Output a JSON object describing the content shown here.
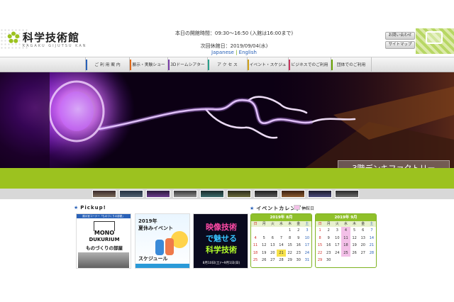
{
  "header": {
    "logo_name": "科学技術館",
    "logo_roman": "KAGAKU GIJUTSU KAN",
    "hours": "本日の開館時間：09:30～16:50 (入館は16:00まで)",
    "next_closed": "次回休館日：2019/09/04(水)",
    "lang_ja": "Japanese",
    "lang_sep": "|",
    "lang_en": "English",
    "contact_button": "お問い合わせ",
    "sitemap_button": "サイトマップ"
  },
  "nav": {
    "items": [
      {
        "label": "ご 利 用 案 内",
        "color": "#2a62b8"
      },
      {
        "label": "展示・実験ショー",
        "color": "#e06a1b"
      },
      {
        "label": "3Dドームシアター",
        "color": "#7a3ea8"
      },
      {
        "label": "ア ク セ ス",
        "color": "#2aa08c"
      },
      {
        "label": "イベント・スケジュール",
        "color": "#d0a21a"
      },
      {
        "label": "ビジネスでのご利用",
        "color": "#c8365e"
      },
      {
        "label": "団体でのご利用",
        "color": "#69a300"
      }
    ]
  },
  "hero": {
    "caption": "3階デンキファクトリー"
  },
  "pickup": {
    "title": "Pickup!",
    "card1": {
      "top": "展示室コーナー「ものづくりの部屋」",
      "mono": "MONO",
      "dukurium": "DUKURIUM",
      "sub": "ものづくりの部屋"
    },
    "card2": {
      "year": "2019年",
      "title": "夏休みイベント",
      "subtitle": "スケジュール"
    },
    "card3": {
      "line1": "映像技術",
      "line2": "で魅せる",
      "line3": "科学技術",
      "date": "8月10日(土)〜9月1日(日)"
    }
  },
  "calendar": {
    "title": "イベントカレンダー",
    "legend": "休館日",
    "dow": [
      "日",
      "月",
      "火",
      "水",
      "木",
      "金",
      "土"
    ],
    "months": [
      {
        "label": "2019年 8月",
        "days": [
          "",
          "",
          "",
          "",
          "1",
          "2",
          "3",
          "4",
          "5",
          "6",
          "7",
          "8",
          "9",
          "10",
          "11",
          "12",
          "13",
          "14",
          "15",
          "16",
          "17",
          "18",
          "19",
          "20",
          "21",
          "22",
          "23",
          "24",
          "25",
          "26",
          "27",
          "28",
          "29",
          "30",
          "31"
        ],
        "today": "21",
        "closed": []
      },
      {
        "label": "2019年 9月",
        "days": [
          "1",
          "2",
          "3",
          "4",
          "5",
          "6",
          "7",
          "8",
          "9",
          "10",
          "11",
          "12",
          "13",
          "14",
          "15",
          "16",
          "17",
          "18",
          "19",
          "20",
          "21",
          "22",
          "23",
          "24",
          "25",
          "26",
          "27",
          "28",
          "29",
          "30"
        ],
        "today": "",
        "closed": [
          "4",
          "11",
          "18",
          "25"
        ]
      }
    ]
  },
  "colors": {
    "accent_green": "#9cc21f",
    "link_blue": "#2a62b8"
  }
}
